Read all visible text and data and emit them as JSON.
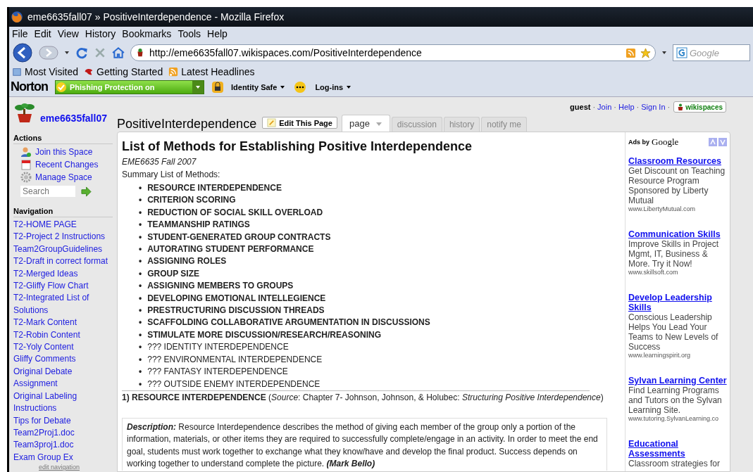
{
  "window": {
    "title": "eme6635fall07 » PositiveInterdependence - Mozilla Firefox"
  },
  "menu": [
    "File",
    "Edit",
    "View",
    "History",
    "Bookmarks",
    "Tools",
    "Help"
  ],
  "address": {
    "value": "http://eme6635fall07.wikispaces.com/PositiveInterdependence"
  },
  "web_search": {
    "placeholder": "Google"
  },
  "bookmarks": [
    {
      "label": "Most Visited",
      "kind": "page"
    },
    {
      "label": "Getting Started",
      "kind": "bird"
    },
    {
      "label": "Latest Headlines",
      "kind": "feed"
    }
  ],
  "norton": {
    "brand": "Norton",
    "phishing": "Phishing Protection on",
    "identity": "Identity Safe",
    "logins": "Log-ins"
  },
  "site": {
    "name": "eme6635fall07",
    "user": "guest",
    "separators": [
      "·",
      "·",
      "·",
      "·"
    ],
    "links": [
      "Join",
      "Help",
      "Sign In"
    ],
    "badge": "wikispaces"
  },
  "page_title": "PositiveInterdependence",
  "edit_button": "Edit This Page",
  "tabs": [
    {
      "label": "page",
      "selected": true
    },
    {
      "label": "discussion",
      "selected": false
    },
    {
      "label": "history",
      "selected": false
    },
    {
      "label": "notify me",
      "selected": false
    }
  ],
  "sidebar": {
    "actions_heading": "Actions",
    "actions": [
      {
        "label": "Join this Space",
        "kind": "user"
      },
      {
        "label": "Recent Changes",
        "kind": "calendar"
      },
      {
        "label": "Manage Space",
        "kind": "gear"
      }
    ],
    "search": {
      "placeholder": "Search"
    },
    "nav_heading": "Navigation",
    "nav": [
      "T2-HOME PAGE",
      "T2-Project 2 Instructions",
      "Team2GroupGuidelines",
      "T2-Draft in correct format",
      "T2-Merged Ideas",
      "T2-Gliffy Flow Chart",
      "T2-Integrated List of Solutions",
      "T2-Mark Content",
      "T2-Robin Content",
      "T2-Yoly Content",
      "Gliffy Comments",
      "Original Debate Assignment",
      "Original Labeling Instructions",
      "Tips for Debate",
      "Team2Proj1.doc",
      "Team3proj1.doc",
      "Exam Group Ex"
    ],
    "edit_nav": "edit navigation"
  },
  "article": {
    "heading": "List of Methods for Establishing Positive Interdependence",
    "subtitle": "EME6635 Fall 2007",
    "summary": "Summary List of Methods:",
    "methods": [
      {
        "marker": "•",
        "text": "RESOURCE INTERDEPENDENCE",
        "kind": "bold"
      },
      {
        "marker": "•",
        "text": "CRITERION SCORING",
        "kind": "bold"
      },
      {
        "marker": "•",
        "text": "REDUCTION OF SOCIAL SKILL OVERLOAD",
        "kind": "bold"
      },
      {
        "marker": "•",
        "text": "TEAMMANSHIP RATINGS",
        "kind": "bold"
      },
      {
        "marker": "•",
        "text": "STUDENT-GENERATED GROUP CONTRACTS",
        "kind": "bold"
      },
      {
        "marker": "•",
        "text": "AUTORATING STUDENT PERFORMANCE",
        "kind": "bold"
      },
      {
        "marker": "•",
        "text": "ASSIGNING ROLES",
        "kind": "bold"
      },
      {
        "marker": "•",
        "text": "GROUP SIZE",
        "kind": "bold"
      },
      {
        "marker": "•",
        "text": "ASSIGNING MEMBERS TO GROUPS",
        "kind": "bold"
      },
      {
        "marker": "•",
        "text": "DEVELOPING EMOTIONAL INTELLEGIENCE",
        "kind": "bold"
      },
      {
        "marker": "•",
        "text": "PRESTRUCTURING DISCUSSION THREADS",
        "kind": "bold"
      },
      {
        "marker": "•",
        "text": "SCAFFOLDING COLLABORATIVE ARGUMENTATION IN DISCUSSIONS",
        "kind": "bold"
      },
      {
        "marker": "•",
        "text": "STIMULATE MORE DISCUSSION/RESEARCH/REASONING",
        "kind": "bold"
      },
      {
        "marker": "•",
        "text": "??? IDENTITY INTERDEPENDENCE",
        "kind": "plain"
      },
      {
        "marker": "•",
        "text": "??? ENVIRONMENTAL INTERDEPENDENCE",
        "kind": "plain"
      },
      {
        "marker": "•",
        "text": "??? FANTASY INTERDEPENDENCE",
        "kind": "plain"
      },
      {
        "marker": "•",
        "text": "??? OUTSIDE ENEMY INTERDEPENDENCE",
        "kind": "plain"
      }
    ],
    "section": "**1) RESOURCE INTERDEPENDENCE** (*Source*: Chapter 7- Johnson, Johnson, & Holubec: *Structuring Positive Interdependence*)",
    "description": "**Description:** Resource Interdependence describes the method of giving each member of the group only a portion of the information, materials, or other items they are required to successfully complete/engage in an activity. In order to meet the end goal, students must work together to exchange what they know/have and develop the final product. Success depends on working together to understand complete the picture. **(Mark Bello)**"
  },
  "ads": {
    "label": "Ads by",
    "brand": "Google",
    "items": [
      {
        "title": "Classroom Resources",
        "text": "Get Discount on Teaching Resource Program Sponsored by Liberty Mutual",
        "url": "www.LibertyMutual.com"
      },
      {
        "title": "Communication Skills",
        "text": "Improve Skills in Project Mgmt, IT, Business & More. Try it Now!",
        "url": "www.skillsoft.com"
      },
      {
        "title": "Develop Leadership Skills",
        "text": "Conscious Leadership Helps You Lead Your Teams to New Levels of Success",
        "url": "www.learningspirit.org"
      },
      {
        "title": "Sylvan Learning Center",
        "text": "Find Learning Programs and Tutors on the Sylvan Learning Site.",
        "url": "www.tutoring.SylvanLearning.co"
      },
      {
        "title": "Educational Assessments",
        "text": "Classroom strategies for"
      }
    ]
  }
}
